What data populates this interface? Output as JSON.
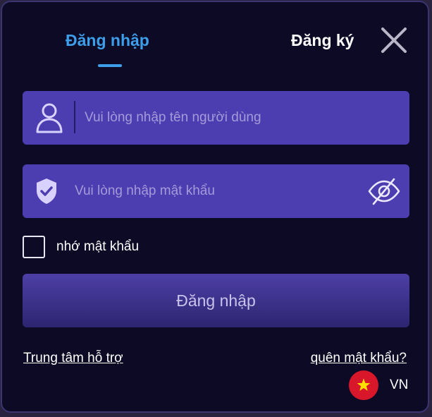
{
  "tabs": {
    "login": "Đăng nhập",
    "register": "Đăng ký"
  },
  "username": {
    "placeholder": "Vui lòng nhập tên người dùng",
    "value": ""
  },
  "password": {
    "placeholder": "Vui lòng nhập mật khẩu",
    "value": ""
  },
  "remember": {
    "label": "nhớ mật khẩu",
    "checked": false
  },
  "submit_label": "Đăng nhập",
  "links": {
    "support": "Trung tâm hỗ trợ",
    "forgot": "quên mật khẩu?"
  },
  "language": {
    "code": "VN",
    "flag_color": "#d8172b"
  },
  "colors": {
    "accent": "#3d9eea",
    "panel": "#0d0a25",
    "field": "#4c3db0"
  },
  "icons": {
    "close": "close-icon",
    "user": "user-icon",
    "shield": "shield-check-icon",
    "eye": "eye-slash-icon",
    "star": "star-icon"
  }
}
